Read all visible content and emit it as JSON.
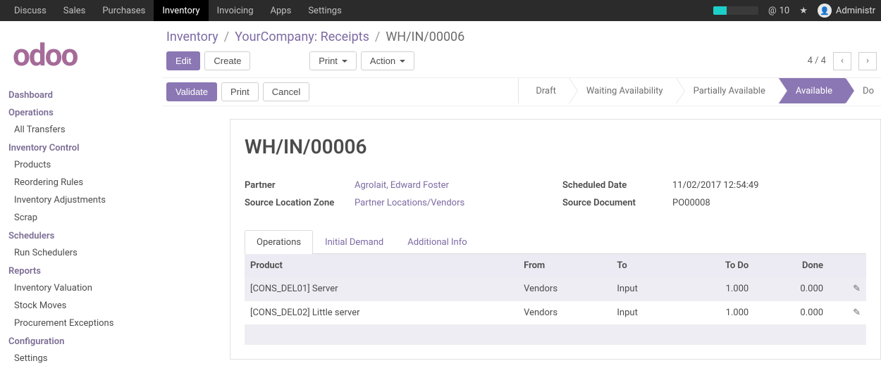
{
  "topnav": {
    "items": [
      "Discuss",
      "Sales",
      "Purchases",
      "Inventory",
      "Invoicing",
      "Apps",
      "Settings"
    ],
    "active_index": 3,
    "msg_count": "10",
    "username": "Administr"
  },
  "logo": "odoo",
  "sidebar": [
    {
      "title": "Dashboard",
      "items": []
    },
    {
      "title": "Operations",
      "items": [
        "All Transfers"
      ]
    },
    {
      "title": "Inventory Control",
      "items": [
        "Products",
        "Reordering Rules",
        "Inventory Adjustments",
        "Scrap"
      ]
    },
    {
      "title": "Schedulers",
      "items": [
        "Run Schedulers"
      ]
    },
    {
      "title": "Reports",
      "items": [
        "Inventory Valuation",
        "Stock Moves",
        "Procurement Exceptions"
      ]
    },
    {
      "title": "Configuration",
      "items": [
        "Settings"
      ]
    }
  ],
  "breadcrumb": {
    "a": "Inventory",
    "b": "YourCompany: Receipts",
    "c": "WH/IN/00006"
  },
  "toolbar": {
    "edit": "Edit",
    "create": "Create",
    "print": "Print",
    "action": "Action",
    "pager": "4 / 4"
  },
  "status_buttons": {
    "validate": "Validate",
    "print": "Print",
    "cancel": "Cancel"
  },
  "workflow": [
    "Draft",
    "Waiting Availability",
    "Partially Available",
    "Available",
    "Do"
  ],
  "workflow_active_index": 3,
  "record": {
    "title": "WH/IN/00006",
    "partner_label": "Partner",
    "partner_value": "Agrolait, Edward Foster",
    "srcloc_label": "Source Location Zone",
    "srcloc_value": "Partner Locations/Vendors",
    "sched_label": "Scheduled Date",
    "sched_value": "11/02/2017 12:54:49",
    "srcdoc_label": "Source Document",
    "srcdoc_value": "PO00008"
  },
  "tabs": [
    "Operations",
    "Initial Demand",
    "Additional Info"
  ],
  "tabs_active_index": 0,
  "columns": {
    "product": "Product",
    "from": "From",
    "to": "To",
    "todo": "To Do",
    "done": "Done"
  },
  "rows": [
    {
      "product": "[CONS_DEL01] Server",
      "from": "Vendors",
      "to": "Input",
      "todo": "1.000",
      "done": "0.000"
    },
    {
      "product": "[CONS_DEL02] Little server",
      "from": "Vendors",
      "to": "Input",
      "todo": "1.000",
      "done": "0.000"
    }
  ]
}
